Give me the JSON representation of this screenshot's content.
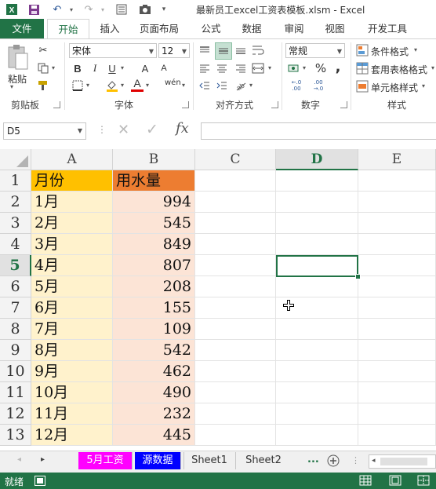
{
  "window": {
    "title": "最新员工excel工资表模板.xlsm - Excel"
  },
  "ribbon": {
    "tabs": {
      "file": "文件",
      "home": "开始",
      "insert": "插入",
      "page_layout": "页面布局",
      "formulas": "公式",
      "data": "数据",
      "review": "审阅",
      "view": "视图",
      "developer": "开发工具"
    },
    "clipboard": {
      "paste": "粘贴",
      "label": "剪贴板"
    },
    "font": {
      "name": "宋体",
      "size": "12",
      "label": "字体",
      "bold": "B",
      "italic": "I",
      "underline": "U",
      "grow": "A",
      "shrink": "A",
      "font_color_glyph": "A",
      "phonetic": "wén"
    },
    "alignment": {
      "label": "对齐方式"
    },
    "number": {
      "format": "常规",
      "label": "数字",
      "percent": "%",
      "comma": ",",
      "inc_decimal": "←.0 .00",
      "dec_decimal": ".00 →.0"
    },
    "styles": {
      "conditional": "条件格式",
      "table_format": "套用表格格式",
      "cell_styles": "单元格样式",
      "label": "样式"
    }
  },
  "formula_bar": {
    "name_box": "D5",
    "cancel": "✕",
    "enter": "✓",
    "fx": "fx",
    "value": ""
  },
  "columns": [
    "A",
    "B",
    "C",
    "D",
    "E"
  ],
  "rows": [
    "1",
    "2",
    "3",
    "4",
    "5",
    "6",
    "7",
    "8",
    "9",
    "10",
    "11",
    "12",
    "13"
  ],
  "sheet": {
    "headers": {
      "month": "月份",
      "water": "用水量"
    },
    "data": [
      {
        "month": "1月",
        "water": "994"
      },
      {
        "month": "2月",
        "water": "545"
      },
      {
        "month": "3月",
        "water": "849"
      },
      {
        "month": "4月",
        "water": "807"
      },
      {
        "month": "5月",
        "water": "208"
      },
      {
        "month": "6月",
        "water": "155"
      },
      {
        "month": "7月",
        "water": "109"
      },
      {
        "month": "8月",
        "water": "542"
      },
      {
        "month": "9月",
        "water": "462"
      },
      {
        "month": "10月",
        "water": "490"
      },
      {
        "month": "11月",
        "water": "232"
      },
      {
        "month": "12月",
        "water": "445"
      }
    ]
  },
  "sheet_tabs": [
    {
      "label": "5月工资",
      "bg": "#ff00ff",
      "fg": "#ffffff"
    },
    {
      "label": "源数据",
      "bg": "#0000ff",
      "fg": "#ffffff"
    },
    {
      "label": "Sheet1",
      "bg": "#f0f0f0",
      "fg": "#333333"
    },
    {
      "label": "Sheet2",
      "bg": "#f0f0f0",
      "fg": "#333333"
    }
  ],
  "sheet_more": "...",
  "status": {
    "ready": "就绪"
  },
  "colors": {
    "excel_green": "#217346",
    "header_a": "#ffc000",
    "header_b": "#ed7d31",
    "fill_a": "#fff2cc",
    "fill_b": "#fce4d6",
    "selected": "#217346"
  }
}
